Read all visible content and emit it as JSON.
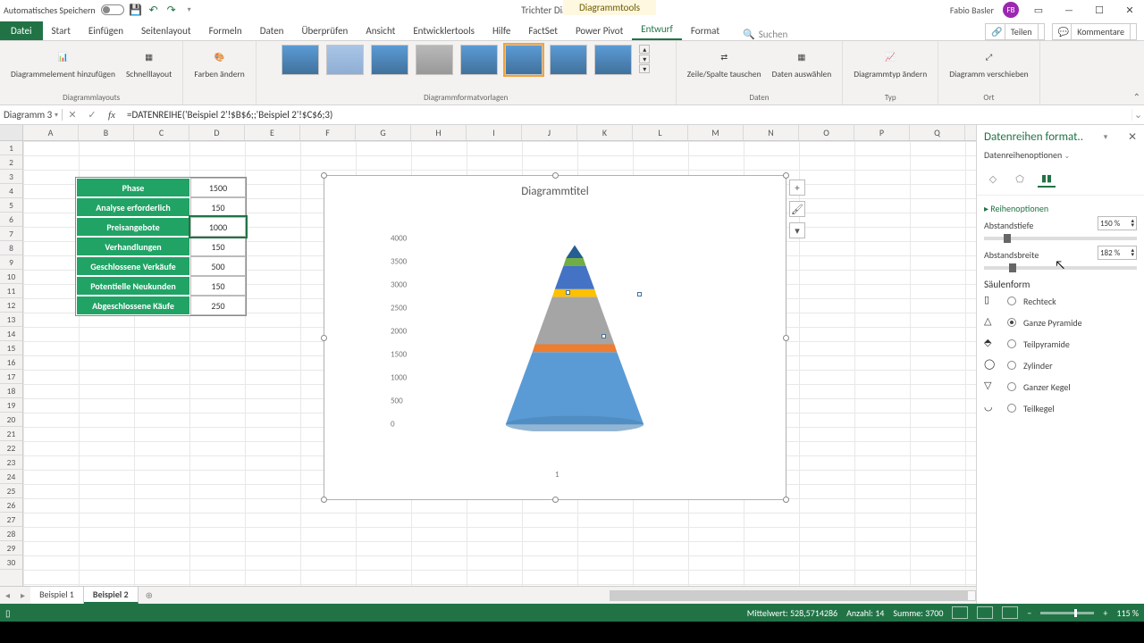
{
  "titlebar": {
    "autosave": "Automatisches Speichern",
    "doc_title": "Trichter Diagramm - Excel",
    "contextual": "Diagrammtools",
    "user": "Fabio Basler"
  },
  "tabs": {
    "file": "Datei",
    "items": [
      "Start",
      "Einfügen",
      "Seitenlayout",
      "Formeln",
      "Daten",
      "Überprüfen",
      "Ansicht",
      "Entwicklertools",
      "Hilfe",
      "FactSet",
      "Power Pivot",
      "Entwurf",
      "Format"
    ],
    "active": "Entwurf",
    "search_placeholder": "Suchen",
    "share": "Teilen",
    "comments": "Kommentare"
  },
  "ribbon": {
    "g1": {
      "btn1": "Diagrammelement\nhinzufügen",
      "btn2": "Schnelllayout",
      "label": "Diagrammlayouts"
    },
    "g2": {
      "btn": "Farben\nändern"
    },
    "g3": {
      "label": "Diagrammformatvorlagen"
    },
    "g4": {
      "btn1": "Zeile/Spalte\ntauschen",
      "btn2": "Daten\nauswählen",
      "label": "Daten"
    },
    "g5": {
      "btn": "Diagrammtyp\nändern",
      "label": "Typ"
    },
    "g6": {
      "btn": "Diagramm\nverschieben",
      "label": "Ort"
    }
  },
  "formula": {
    "name": "Diagramm 3",
    "text": "=DATENREIHE('Beispiel 2'!$B$6;;'Beispiel 2'!$C$6;3)"
  },
  "columns": [
    "A",
    "B",
    "C",
    "D",
    "E",
    "F",
    "G",
    "H",
    "I",
    "J",
    "K",
    "L",
    "M",
    "N",
    "O",
    "P",
    "Q"
  ],
  "data_table": [
    {
      "label": "Phase",
      "value": "1500"
    },
    {
      "label": "Analyse erforderlich",
      "value": "150"
    },
    {
      "label": "Preisangebote",
      "value": "1000"
    },
    {
      "label": "Verhandlungen",
      "value": "150"
    },
    {
      "label": "Geschlossene Verkäufe",
      "value": "500"
    },
    {
      "label": "Potentielle Neukunden",
      "value": "150"
    },
    {
      "label": "Abgeschlossene Käufe",
      "value": "250"
    }
  ],
  "chart": {
    "title": "Diagrammtitel",
    "ylabels": [
      "4000",
      "3500",
      "3000",
      "2500",
      "2000",
      "1500",
      "1000",
      "500",
      "0"
    ],
    "category": "1"
  },
  "chart_data": {
    "type": "bar",
    "subtype": "3d-stacked-pyramid",
    "categories": [
      "1"
    ],
    "series": [
      {
        "name": "Phase",
        "values": [
          1500
        ],
        "color": "#5b9bd5"
      },
      {
        "name": "Analyse erforderlich",
        "values": [
          150
        ],
        "color": "#ed7d31"
      },
      {
        "name": "Preisangebote",
        "values": [
          1000
        ],
        "color": "#a5a5a5"
      },
      {
        "name": "Verhandlungen",
        "values": [
          150
        ],
        "color": "#ffc000"
      },
      {
        "name": "Geschlossene Verkäufe",
        "values": [
          500
        ],
        "color": "#4472c4"
      },
      {
        "name": "Potentielle Neukunden",
        "values": [
          150
        ],
        "color": "#70ad47"
      },
      {
        "name": "Abgeschlossene Käufe",
        "values": [
          250
        ],
        "color": "#255e91"
      }
    ],
    "ylim": [
      0,
      4000
    ],
    "title": "Diagrammtitel"
  },
  "format_pane": {
    "title": "Datenreihen format..",
    "subtitle": "Datenreihenoptionen",
    "section": "Reihenoptionen",
    "gap_depth_label": "Abstandstiefe",
    "gap_depth_value": "150 %",
    "gap_width_label": "Abstandsbreite",
    "gap_width_value": "182 %",
    "shape_label": "Säulenform",
    "shapes": [
      "Rechteck",
      "Ganze Pyramide",
      "Teilpyramide",
      "Zylinder",
      "Ganzer Kegel",
      "Teilkegel"
    ],
    "shape_selected": "Ganze Pyramide"
  },
  "sheets": {
    "items": [
      "Beispiel 1",
      "Beispiel 2"
    ],
    "active": "Beispiel 2"
  },
  "status": {
    "avg_label": "Mittelwert:",
    "avg": "528,5714286",
    "count_label": "Anzahl:",
    "count": "14",
    "sum_label": "Summe:",
    "sum": "3700",
    "zoom": "115 %"
  }
}
